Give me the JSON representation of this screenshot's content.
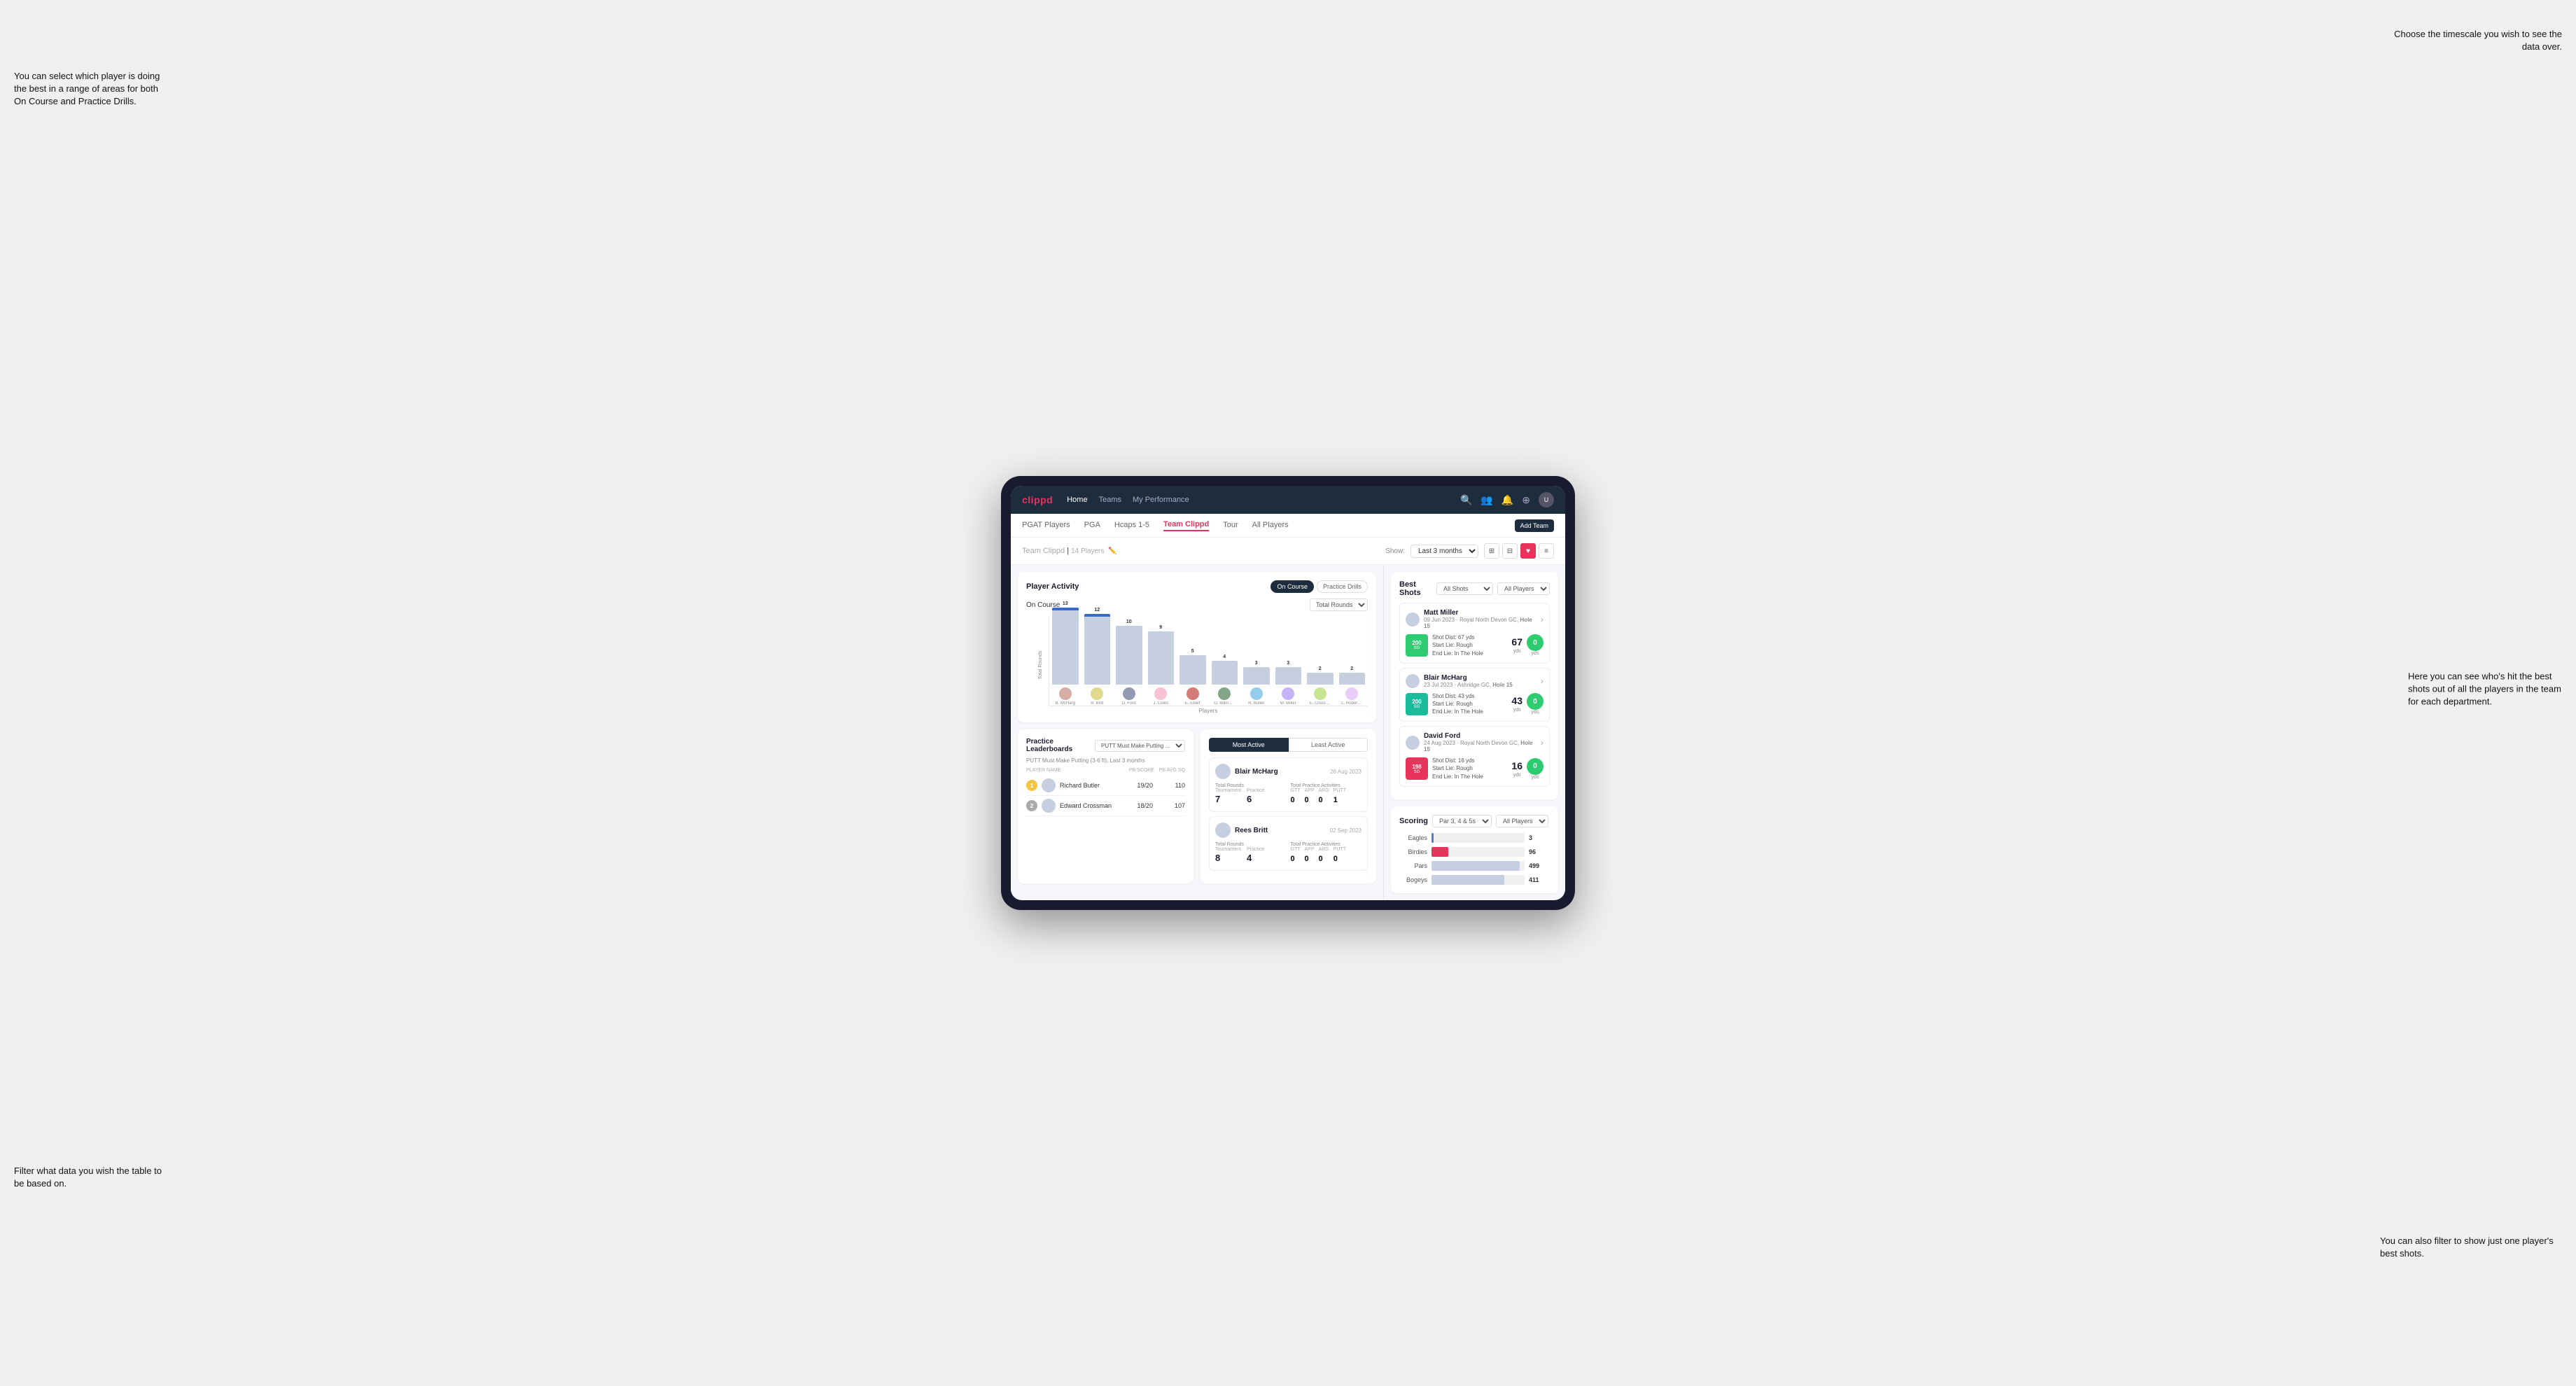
{
  "annotations": {
    "top_left": "You can select which player is doing the best in a range of areas for both On Course and Practice Drills.",
    "bottom_left": "Filter what data you wish the table to be based on.",
    "top_right": "Choose the timescale you wish to see the data over.",
    "mid_right": "Here you can see who's hit the best shots out of all the players in the team for each department.",
    "bottom_right": "You can also filter to show just one player's best shots."
  },
  "nav": {
    "logo": "clippd",
    "links": [
      "Home",
      "Teams",
      "My Performance"
    ],
    "icons": [
      "search",
      "users",
      "bell",
      "plus",
      "user"
    ]
  },
  "sub_nav": {
    "links": [
      "PGAT Players",
      "PGA",
      "Hcaps 1-5",
      "Team Clippd",
      "Tour",
      "All Players"
    ],
    "active": "Team Clippd",
    "add_team_btn": "Add Team"
  },
  "team_header": {
    "title": "Team Clippd",
    "players_count": "14 Players",
    "show_label": "Show:",
    "timescale": "Last 3 months",
    "view_modes": [
      "grid",
      "grid2",
      "heart",
      "list"
    ]
  },
  "player_activity": {
    "title": "Player Activity",
    "toggle_on_course": "On Course",
    "toggle_practice": "Practice Drills",
    "chart_section_title": "On Course",
    "chart_dropdown": "Total Rounds",
    "y_axis_label": "Total Rounds",
    "x_axis_label": "Players",
    "bars": [
      {
        "name": "B. McHarg",
        "value": 13,
        "highlight": true
      },
      {
        "name": "R. Britt",
        "value": 12,
        "highlight": true
      },
      {
        "name": "D. Ford",
        "value": 10,
        "highlight": false
      },
      {
        "name": "J. Coles",
        "value": 9,
        "highlight": false
      },
      {
        "name": "E. Ebert",
        "value": 5,
        "highlight": false
      },
      {
        "name": "O. Billingham",
        "value": 4,
        "highlight": false
      },
      {
        "name": "R. Butler",
        "value": 3,
        "highlight": false
      },
      {
        "name": "M. Miller",
        "value": 3,
        "highlight": false
      },
      {
        "name": "E. Crossman",
        "value": 2,
        "highlight": false
      },
      {
        "name": "L. Robertson",
        "value": 2,
        "highlight": false
      }
    ]
  },
  "best_shots": {
    "title": "Best Shots",
    "filter1": "All Shots",
    "filter2": "All Players",
    "players": [
      {
        "name": "Matt Miller",
        "date": "09 Jun 2023 · Royal North Devon GC,",
        "hole": "Hole 15",
        "badge_val": "200",
        "badge_sub": "SG",
        "badge_color": "green",
        "desc": "Shot Dist: 67 yds\nStart Lie: Rough\nEnd Lie: In The Hole",
        "metric1_val": "67",
        "metric1_unit": "yds",
        "metric2_val": "0",
        "metric2_color": "green"
      },
      {
        "name": "Blair McHarg",
        "date": "23 Jul 2023 · Ashridge GC,",
        "hole": "Hole 15",
        "badge_val": "200",
        "badge_sub": "SG",
        "badge_color": "teal",
        "desc": "Shot Dist: 43 yds\nStart Lie: Rough\nEnd Lie: In The Hole",
        "metric1_val": "43",
        "metric1_unit": "yds",
        "metric2_val": "0",
        "metric2_color": "green"
      },
      {
        "name": "David Ford",
        "date": "24 Aug 2023 · Royal North Devon GC,",
        "hole": "Hole 15",
        "badge_val": "198",
        "badge_sub": "SG",
        "badge_color": "pink",
        "desc": "Shot Dist: 16 yds\nStart Lie: Rough\nEnd Lie: In The Hole",
        "metric1_val": "16",
        "metric1_unit": "yds",
        "metric2_val": "0",
        "metric2_color": "green"
      }
    ]
  },
  "practice_leaderboards": {
    "title": "Practice Leaderboards",
    "filter": "PUTT Must Make Putting ...",
    "subtitle": "PUTT Must Make Putting (3-6 ft), Last 3 months",
    "cols": [
      "PLAYER NAME",
      "PB SCORE",
      "PB AVG SQ"
    ],
    "players": [
      {
        "rank": 1,
        "rank_color": "#f5c542",
        "name": "Richard Butler",
        "score": "19/20",
        "avg": "110"
      },
      {
        "rank": 2,
        "rank_color": "#aaa",
        "name": "Edward Crossman",
        "score": "18/20",
        "avg": "107"
      }
    ]
  },
  "most_active": {
    "tabs": [
      "Most Active",
      "Least Active"
    ],
    "active_tab": "Most Active",
    "players": [
      {
        "name": "Blair McHarg",
        "date": "26 Aug 2023",
        "total_rounds_label": "Total Rounds",
        "tournament_label": "Tournament",
        "practice_label": "Practice",
        "tournament_val": "7",
        "practice_val": "6",
        "practice_activities_label": "Total Practice Activities",
        "gtt_label": "GTT",
        "app_label": "APP",
        "arg_label": "ARG",
        "putt_label": "PUTT",
        "gtt_val": "0",
        "app_val": "0",
        "arg_val": "0",
        "putt_val": "1"
      },
      {
        "name": "Rees Britt",
        "date": "02 Sep 2023",
        "total_rounds_label": "Total Rounds",
        "tournament_label": "Tournament",
        "practice_label": "Practice",
        "tournament_val": "8",
        "practice_val": "4",
        "practice_activities_label": "Total Practice Activities",
        "gtt_label": "GTT",
        "app_label": "APP",
        "arg_label": "ARG",
        "putt_label": "PUTT",
        "gtt_val": "0",
        "app_val": "0",
        "arg_val": "0",
        "putt_val": "0"
      }
    ]
  },
  "scoring": {
    "title": "Scoring",
    "filter1": "Par 3, 4 & 5s",
    "filter2": "All Players",
    "rows": [
      {
        "label": "Eagles",
        "value": 3,
        "bar_pct": 2,
        "color": "#4a7fd4"
      },
      {
        "label": "Birdies",
        "value": 96,
        "bar_pct": 18,
        "color": "#e8335d"
      },
      {
        "label": "Pars",
        "value": 499,
        "bar_pct": 95,
        "color": "#c5cfe0"
      },
      {
        "label": "Bogeys",
        "value": 411,
        "bar_pct": 78,
        "color": "#c5cfe0"
      }
    ]
  }
}
